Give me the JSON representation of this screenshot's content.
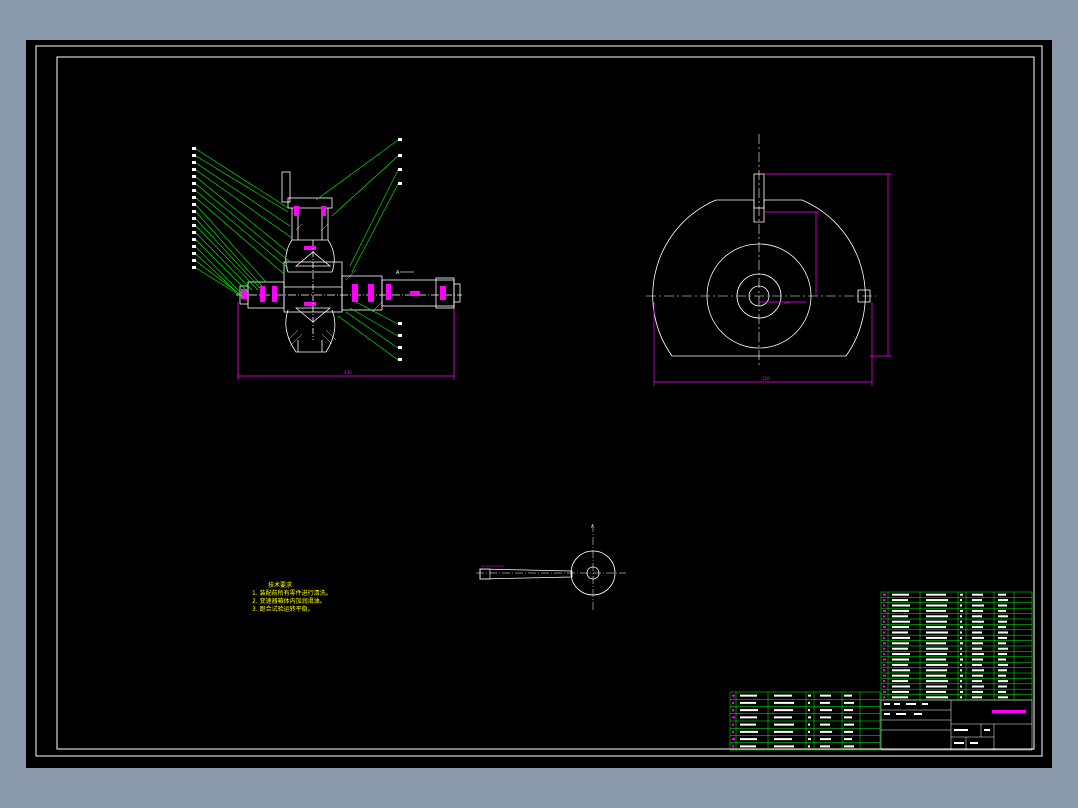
{
  "viewer": {
    "background": "#8a99ab",
    "paper_color": "#000000"
  },
  "drawing": {
    "colors": {
      "outline": "#ffffff",
      "leader": "#00ff00",
      "dimension": "#ff00ff",
      "notes": "#ffff00",
      "table_grid": "#00ff00"
    },
    "technical_notes": {
      "title": "技术要求",
      "items": [
        "1. 装配前所有零件进行清洗。",
        "2. 变速器箱体内加润滑油。",
        "3. 跑合试验运转平稳。"
      ]
    },
    "part_count_main": 20,
    "part_count_left_table": 8
  }
}
